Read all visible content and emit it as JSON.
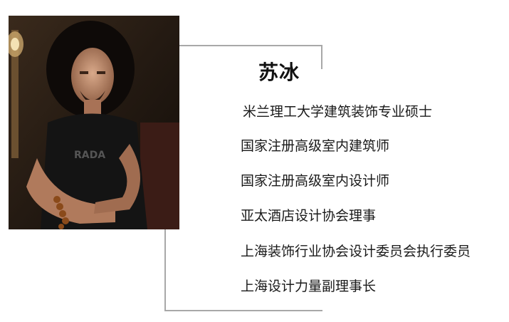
{
  "profile": {
    "name": "苏冰",
    "photo_icon": "portrait-photo",
    "credentials": [
      "米兰理工大学建筑装饰专业硕士",
      "国家注册高级室内建筑师",
      "国家注册高级室内设计师",
      "亚太酒店设计协会理事",
      "上海装饰行业协会设计委员会执行委员",
      "上海设计力量副理事长"
    ]
  },
  "colors": {
    "frame": "#a8a8a8",
    "text": "#1a1a1a",
    "background": "#ffffff"
  }
}
